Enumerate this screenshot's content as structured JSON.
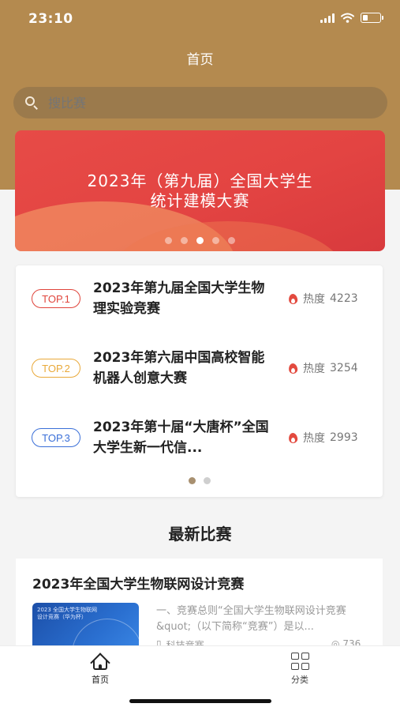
{
  "status_bar": {
    "time": "23:10"
  },
  "header": {
    "title": "首页"
  },
  "search": {
    "placeholder": "搜比赛"
  },
  "banner": {
    "line1": "2023年（第九届）全国大学生",
    "line2": "统计建模大赛",
    "dot_count": 5,
    "active_dot": 2
  },
  "top_list": {
    "items": [
      {
        "rank": "TOP.1",
        "name": "2023年第九届全国大学生物理实验竞赛",
        "heat_label": "热度",
        "heat_value": "4223",
        "color": "#e0453c"
      },
      {
        "rank": "TOP.2",
        "name": "2023年第六届中国高校智能机器人创意大赛",
        "heat_label": "热度",
        "heat_value": "3254",
        "color": "#e9a93a"
      },
      {
        "rank": "TOP.3",
        "name": "2023年第十届“大唐杯”全国大学生新一代信...",
        "heat_label": "热度",
        "heat_value": "2993",
        "color": "#3a6fd8"
      }
    ],
    "dot_count": 2,
    "active_dot": 0
  },
  "latest": {
    "section_title": "最新比赛",
    "card": {
      "title": "2023年全国大学生物联网设计竞赛",
      "thumb_text": "2023 全国大学生物联网\n设计竞赛（华为杯）",
      "description": "一、竞赛总则“全国大学生物联网设计竞赛&quot;（以下简称“竞赛”）是以...",
      "category": "科技竞赛",
      "views": "736"
    }
  },
  "tabbar": {
    "tabs": [
      {
        "label": "首页",
        "icon": "home-icon",
        "active": true
      },
      {
        "label": "分类",
        "icon": "grid-icon",
        "active": false
      }
    ]
  },
  "colors": {
    "header_bg": "#b48a4f",
    "banner_red": "#e34442",
    "top1": "#e0453c",
    "top2": "#e9a93a",
    "top3": "#3a6fd8"
  }
}
